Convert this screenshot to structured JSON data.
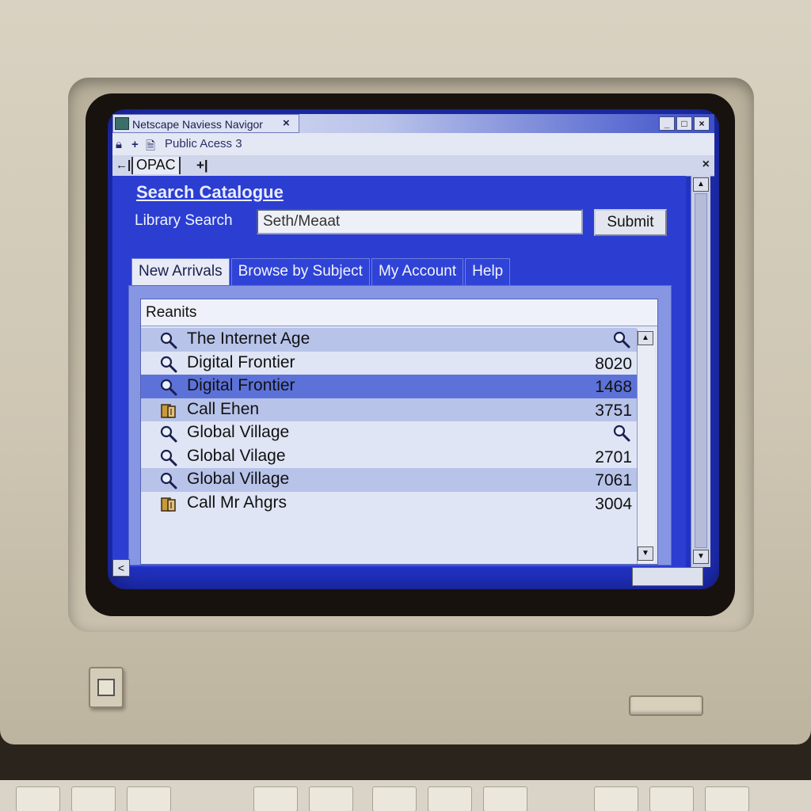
{
  "window": {
    "title": "Netscape Naviess Navigor",
    "tab_close": "×",
    "controls": [
      "_",
      "□",
      "×"
    ]
  },
  "address": {
    "text": "Public Acess 3"
  },
  "tabbar": {
    "back": "←|",
    "tab_label": "OPAC",
    "forward": "+|",
    "close": "×"
  },
  "search": {
    "title": "Search Catalogue",
    "label": "Library Search",
    "value": "Seth/Meaat",
    "submit_label": "Submit"
  },
  "content_tabs": [
    {
      "label": "New Arrivals",
      "active": true
    },
    {
      "label": "Browse by Subject",
      "active": false
    },
    {
      "label": "My Account",
      "active": false
    },
    {
      "label": "Help",
      "active": false
    }
  ],
  "results": {
    "header": "Reanits",
    "rows": [
      {
        "icon": "magnifier-icon",
        "title": "The Internet Age",
        "value": "",
        "value_icon": "magnifier-icon",
        "style": "alt"
      },
      {
        "icon": "magnifier-icon",
        "title": "Digital Frontier",
        "value": "8020",
        "value_icon": "",
        "style": "plain"
      },
      {
        "icon": "magnifier-icon",
        "title": "Digital Frontier",
        "value": "1468",
        "value_icon": "",
        "style": "selected"
      },
      {
        "icon": "book-icon",
        "title": "Call Ehen",
        "value": "3751",
        "value_icon": "",
        "style": "alt"
      },
      {
        "icon": "magnifier-icon",
        "title": "Global Village",
        "value": "",
        "value_icon": "magnifier-icon",
        "style": "plain"
      },
      {
        "icon": "magnifier-icon",
        "title": "Global Vilage",
        "value": "2701",
        "value_icon": "",
        "style": "plain"
      },
      {
        "icon": "magnifier-icon",
        "title": "Global Village",
        "value": "7061",
        "value_icon": "",
        "style": "alt"
      },
      {
        "icon": "book-icon",
        "title": "Call Mr Ahgrs",
        "value": "3004",
        "value_icon": "",
        "style": "plain"
      }
    ]
  },
  "scroll": {
    "up": "▲",
    "down": "▼",
    "left": "<"
  },
  "colors": {
    "screen_bg": "#2233c8",
    "selected_row": "#5c72d8",
    "alt_row": "#b8c3ea"
  }
}
